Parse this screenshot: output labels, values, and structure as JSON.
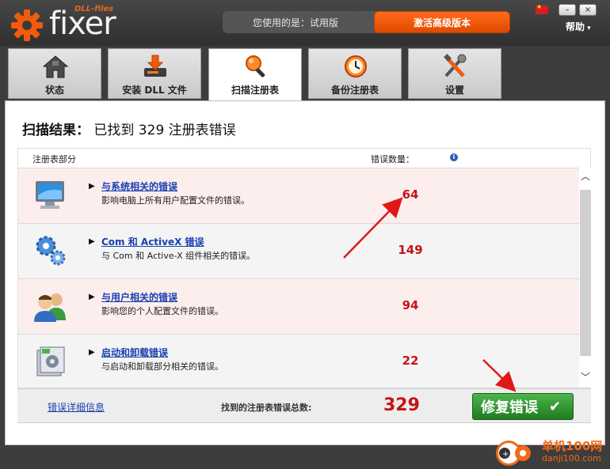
{
  "app": {
    "logo_small": "DLL-files",
    "logo_brand": "fixer"
  },
  "header": {
    "user_label": "您使用的是：试用版",
    "activate_button": "激活高级版本",
    "help_menu": "帮助",
    "window_minimize": "–",
    "window_close": "×"
  },
  "tabs": [
    {
      "label": "状态",
      "icon": "home-icon"
    },
    {
      "label": "安装 DLL 文件",
      "icon": "download-icon"
    },
    {
      "label": "扫描注册表",
      "icon": "magnifier-icon",
      "active": true
    },
    {
      "label": "备份注册表",
      "icon": "clock-icon"
    },
    {
      "label": "设置",
      "icon": "tools-icon"
    }
  ],
  "scan": {
    "heading_label": "扫描结果：",
    "heading_text": "已找到 329 注册表错误",
    "col_section": "注册表部分",
    "col_count": "错误数量：",
    "rows": [
      {
        "title": "与系统相关的错误",
        "desc": "影响电脑上所有用户配置文件的错误。",
        "count": "64",
        "icon": "monitor-icon"
      },
      {
        "title": "Com 和 ActiveX 错误",
        "desc": "与 Com 和 Active-X 组件相关的错误。",
        "count": "149",
        "icon": "gears-icon"
      },
      {
        "title": "与用户相关的错误",
        "desc": "影响您的个人配置文件的错误。",
        "count": "94",
        "icon": "users-icon"
      },
      {
        "title": "启动和卸载错误",
        "desc": "与启动和卸载部分相关的错误。",
        "count": "22",
        "icon": "installer-icon"
      }
    ],
    "details_link": "错误详细信息",
    "total_label": "找到的注册表错误总数:",
    "total_value": "329",
    "fix_button": "修复错误"
  },
  "watermark": {
    "line1": "单机100网",
    "line2": "danji100.com"
  },
  "colors": {
    "accent_orange": "#f25a0c",
    "error_red": "#c41414",
    "fix_green": "#2e9a2e",
    "link_blue": "#1a3fb0"
  }
}
